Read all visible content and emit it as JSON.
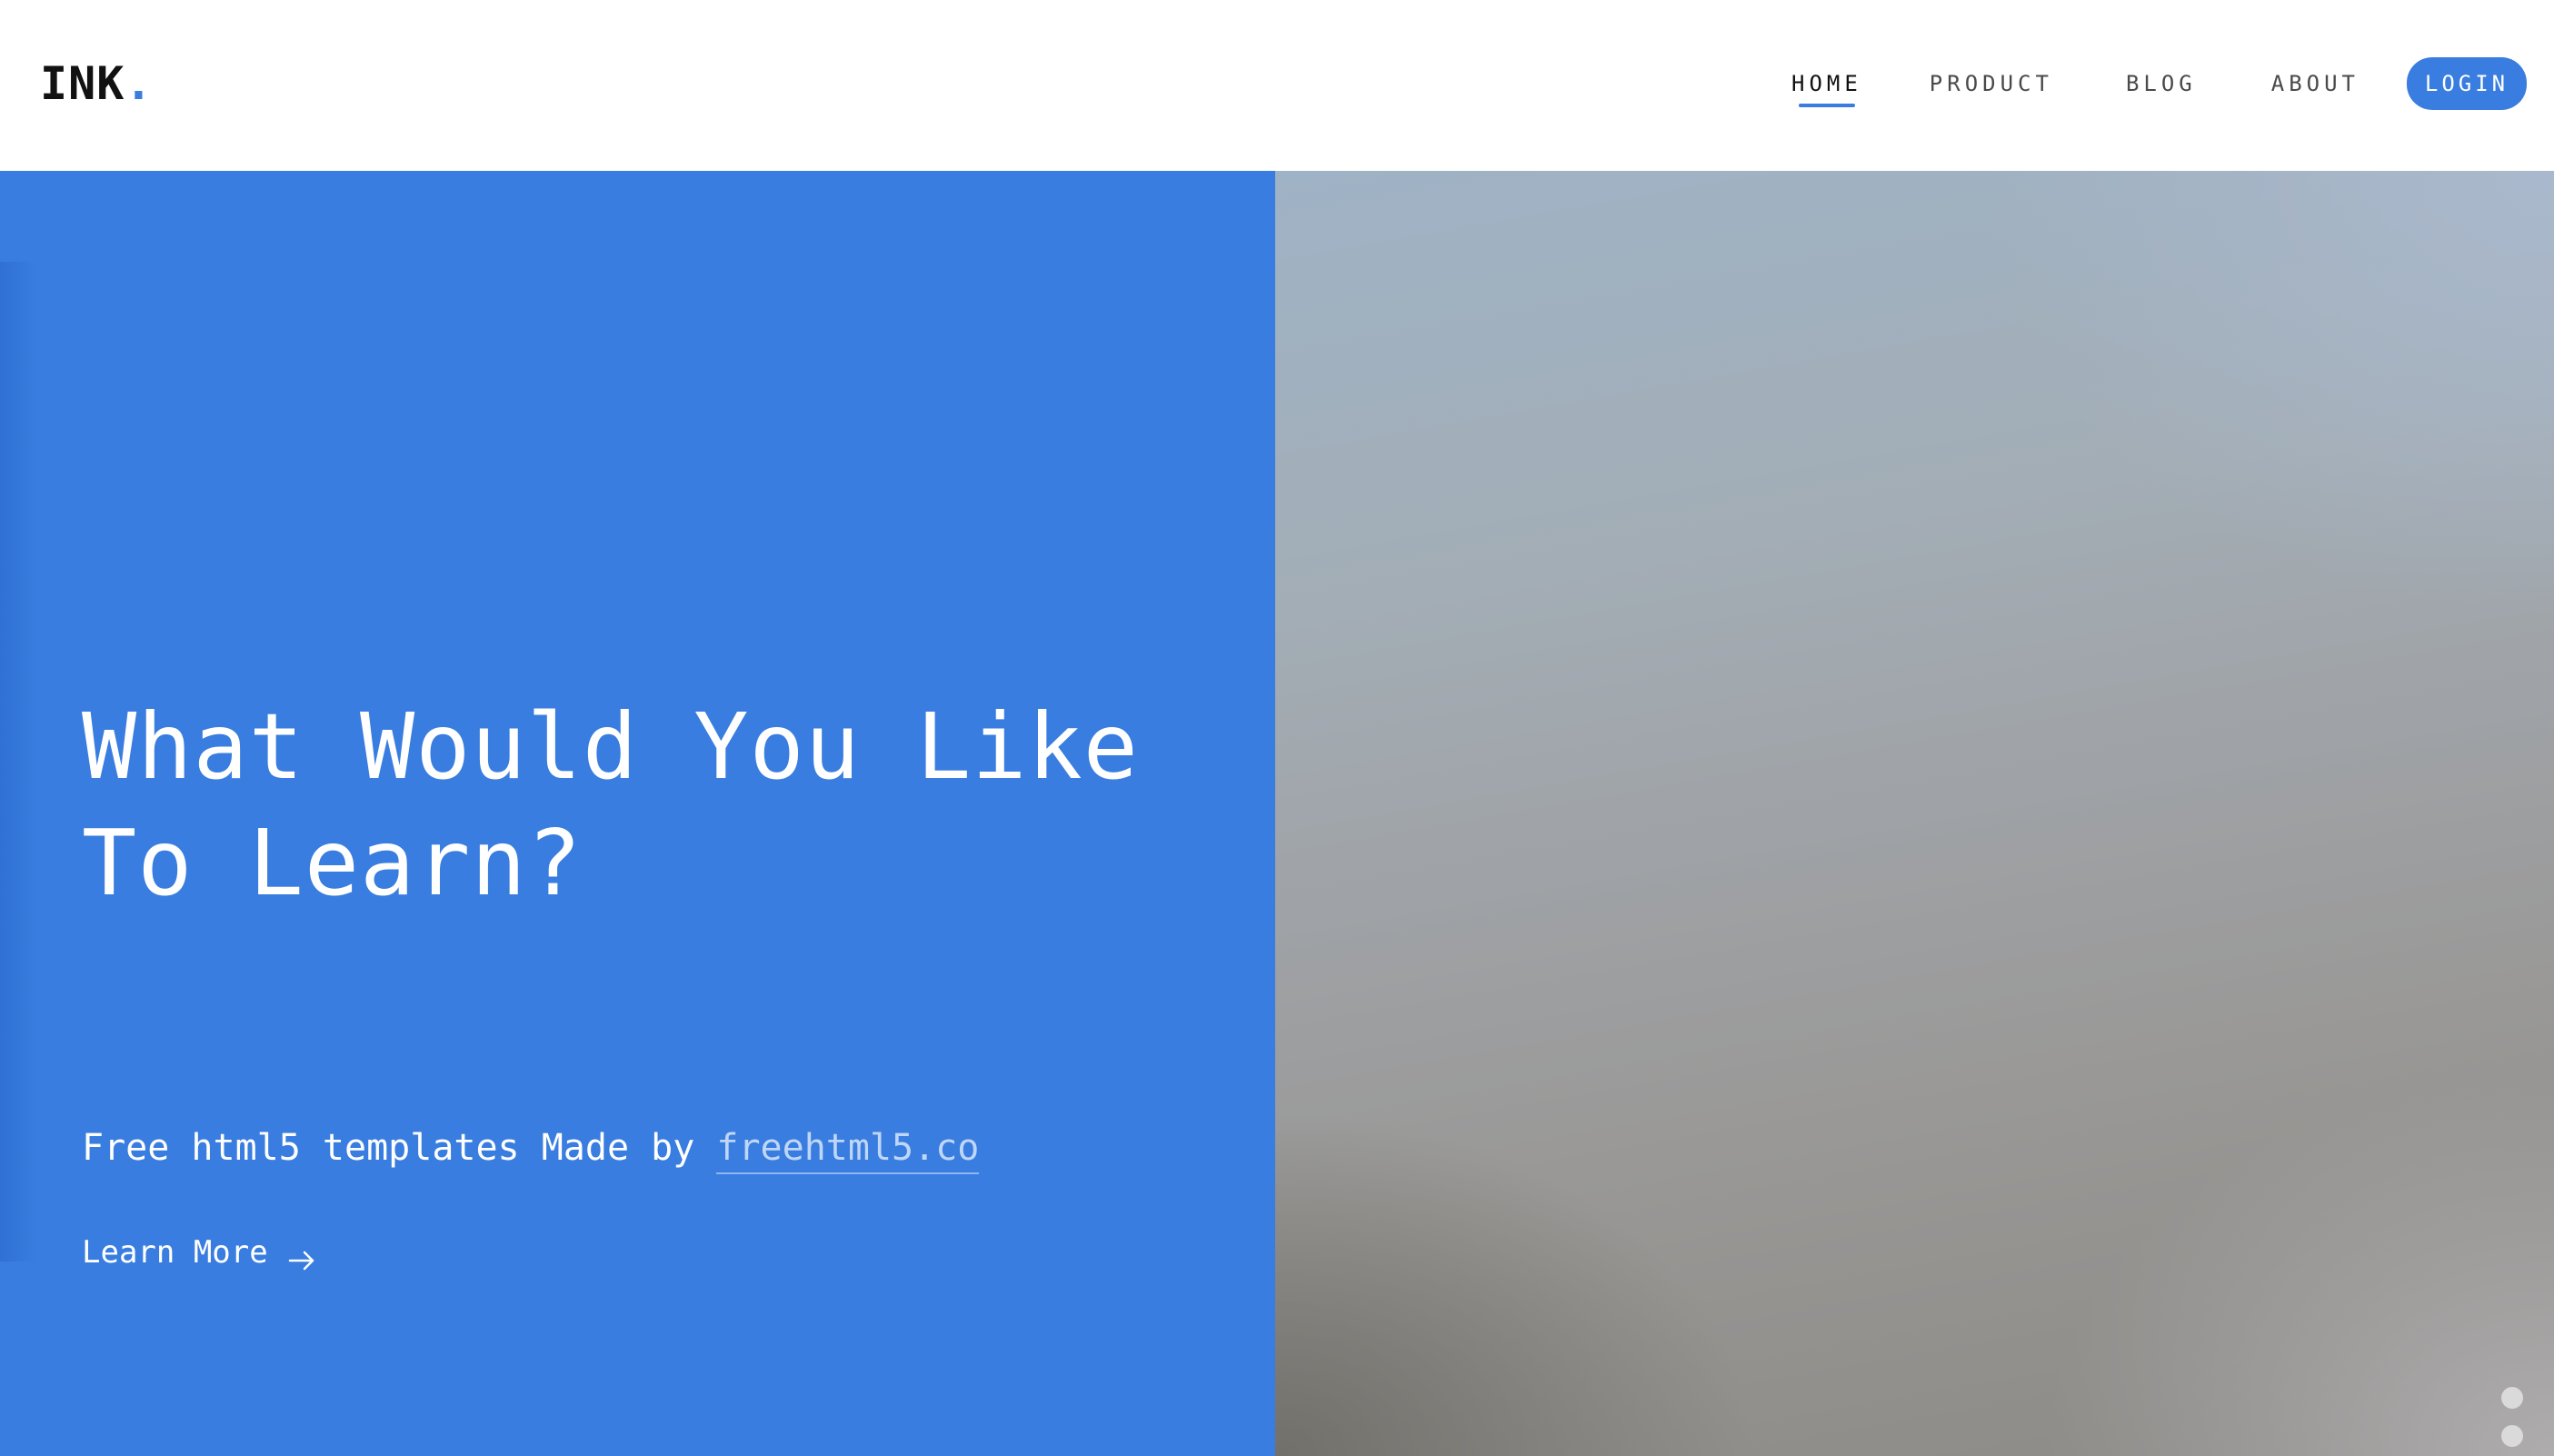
{
  "logo": {
    "text": "INK",
    "dot": "."
  },
  "nav": {
    "items": [
      {
        "label": "HOME",
        "active": true
      },
      {
        "label": "PRODUCT",
        "active": false
      },
      {
        "label": "BLOG",
        "active": false
      },
      {
        "label": "ABOUT",
        "active": false
      }
    ],
    "login_label": "LOGIN"
  },
  "hero": {
    "title": "What Would You Like To Learn?",
    "subtitle_prefix": "Free html5 templates Made by ",
    "subtitle_link": "freehtml5.co",
    "cta_label": "Learn More",
    "cta_icon": "arrow-right-icon"
  },
  "slider": {
    "dot_count": 2
  },
  "colors": {
    "accent": "#387ddf",
    "header_bg": "#ffffff",
    "text_dark": "#111111"
  }
}
